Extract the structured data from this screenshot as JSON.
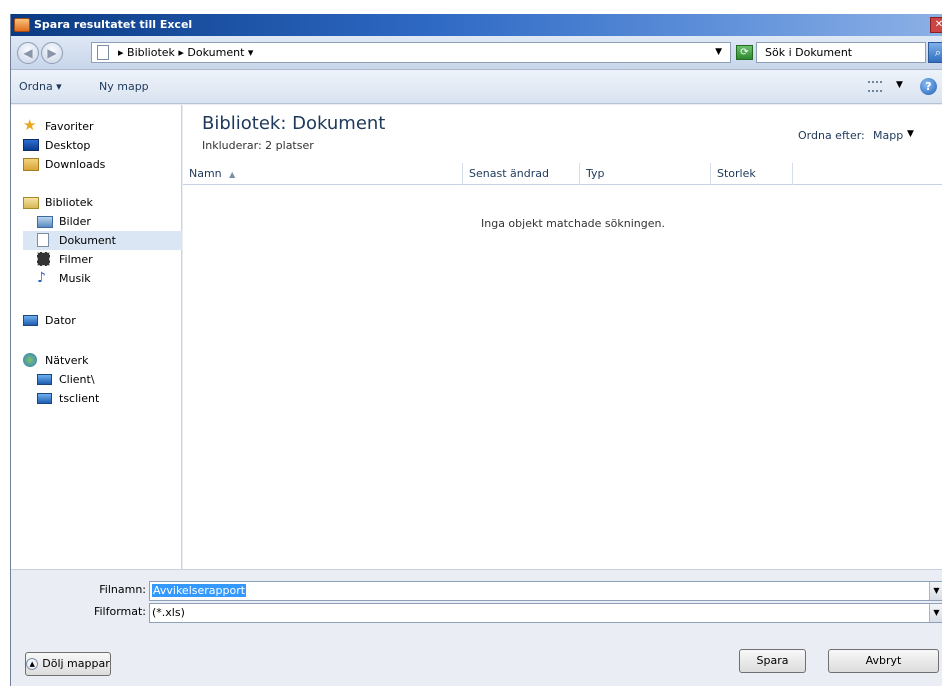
{
  "window": {
    "title": "Spara resultatet till Excel",
    "close_glyph": "✕"
  },
  "nav": {
    "back_icon": "back-arrow-icon",
    "forward_icon": "forward-arrow-icon",
    "breadcrumb": "▸ Bibliotek ▸ Dokument ▾",
    "search_placeholder": "Sök i Dokument"
  },
  "toolbar": {
    "organize_label": "Ordna ▾",
    "new_folder_label": "Ny mapp"
  },
  "sidebar": {
    "favorites": "Favoriter",
    "desktop": "Desktop",
    "downloads": "Downloads",
    "libraries": "Bibliotek",
    "pictures": "Bilder",
    "documents": "Dokument",
    "videos": "Filmer",
    "music": "Musik",
    "computer": "Dator",
    "network": "Nätverk",
    "client": "Client\\",
    "tsclient": "tsclient"
  },
  "content": {
    "library_title": "Bibliotek: Dokument",
    "includes": "Inkluderar: 2 platser",
    "arrange_label": "Ordna efter:",
    "arrange_value": "Mapp",
    "columns": {
      "name": "Namn",
      "modified": "Senast ändrad",
      "type": "Typ",
      "size": "Storlek"
    },
    "empty_message": "Inga objekt matchade sökningen."
  },
  "bottom": {
    "filename_label": "Filnamn:",
    "filename_value": "Avvikelserapport",
    "format_label": "Filformat:",
    "format_value": "(*.xls)",
    "hide_folders_label": "Dölj mappar",
    "save_label": "Spara",
    "cancel_label": "Avbryt"
  },
  "colors": {
    "accent": "#2e69c4",
    "selection": "#3399ff"
  }
}
